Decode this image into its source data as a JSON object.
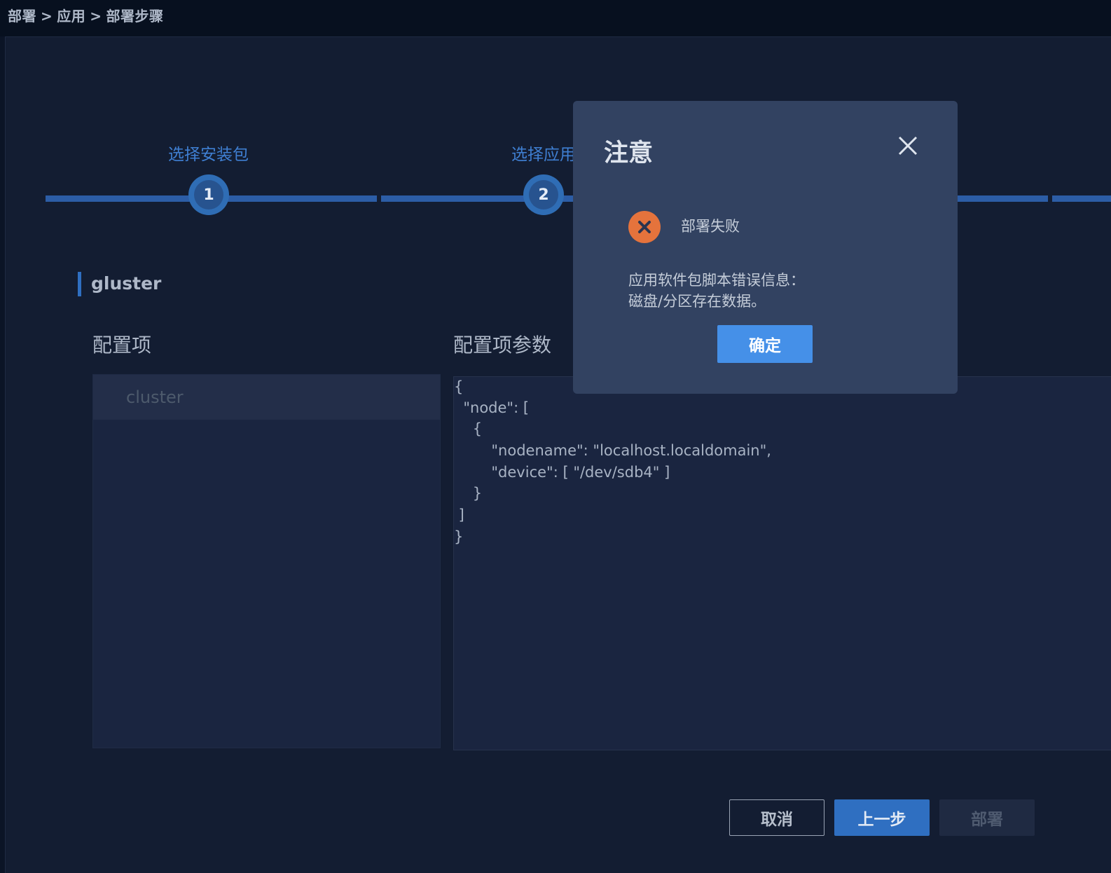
{
  "breadcrumb": {
    "items": [
      "部署",
      "应用",
      "部署步骤"
    ],
    "separator": ">"
  },
  "stepper": {
    "steps": [
      {
        "number": "1",
        "label": "选择安装包"
      },
      {
        "number": "2",
        "label": "选择应用"
      }
    ]
  },
  "section": {
    "title": "gluster"
  },
  "config": {
    "list_title": "配置项",
    "params_title": "配置项参数",
    "items": [
      "cluster"
    ],
    "code_lines": [
      "{",
      "  \"node\": [",
      "    {",
      "        \"nodename\": \"localhost.localdomain\",",
      "        \"device\": [ \"/dev/sdb4\" ]",
      "    }",
      " ]",
      "}"
    ]
  },
  "actions": {
    "cancel": "取消",
    "prev": "上一步",
    "deploy": "部署"
  },
  "modal": {
    "title": "注意",
    "status": "部署失败",
    "error_lines": [
      "应用软件包脚本错误信息：",
      "磁盘/分区存在数据。"
    ],
    "confirm": "确定"
  },
  "colors": {
    "accent": "#2f6fc1",
    "error": "#e5733c",
    "confirm": "#4590e8"
  }
}
